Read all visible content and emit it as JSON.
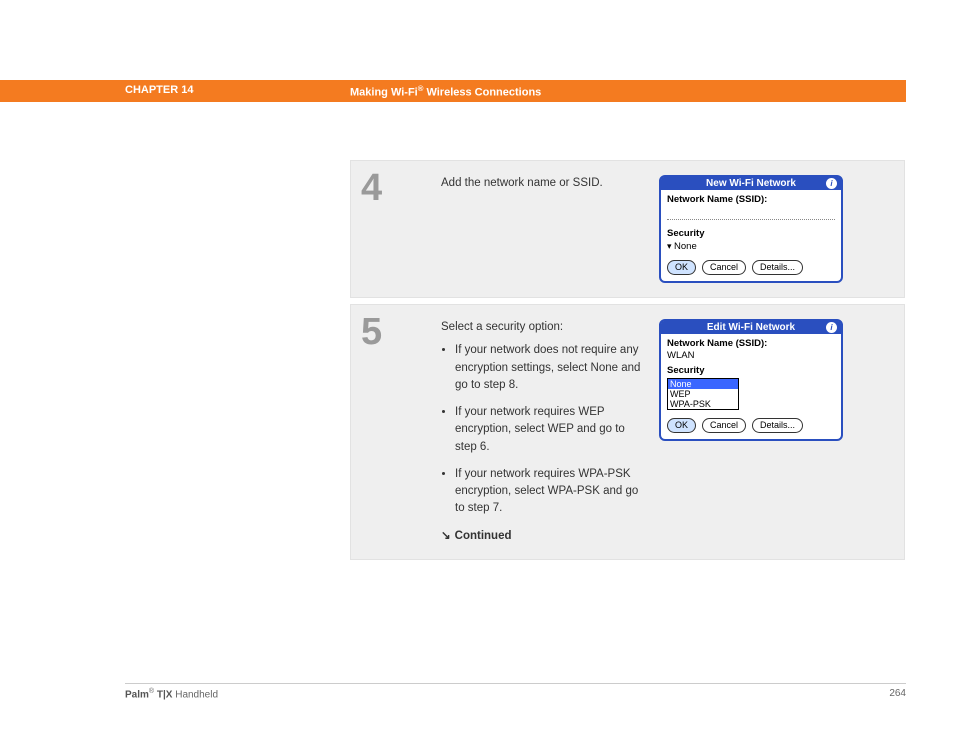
{
  "header": {
    "chapter": "CHAPTER 14",
    "title_pre": "Making Wi-Fi",
    "title_sup": "®",
    "title_post": " Wireless Connections"
  },
  "steps": [
    {
      "num": "4",
      "text": "Add the network name or SSID.",
      "panel": {
        "title": "New Wi-Fi Network",
        "ssid_label": "Network Name (SSID):",
        "ssid_value": "",
        "security_label": "Security",
        "security_value": "None",
        "dropdown_open": false,
        "buttons": {
          "ok": "OK",
          "cancel": "Cancel",
          "details": "Details..."
        }
      }
    },
    {
      "num": "5",
      "intro": "Select a security option:",
      "bullets": [
        "If your network does not require any encryption settings, select None and go to step 8.",
        "If your network requires WEP encryption, select WEP and go to step 6.",
        "If your network requires WPA-PSK encryption, select WPA-PSK and go to step 7."
      ],
      "continued": "Continued",
      "panel": {
        "title": "Edit Wi-Fi Network",
        "ssid_label": "Network Name (SSID):",
        "ssid_value": "WLAN",
        "security_label": "Security",
        "dropdown_open": true,
        "options": [
          "None",
          "WEP",
          "WPA-PSK"
        ],
        "buttons": {
          "ok": "OK",
          "cancel": "Cancel",
          "details": "Details..."
        }
      }
    }
  ],
  "footer": {
    "product_bold": "Palm",
    "product_sup": "®",
    "product_rest": " T|X",
    "product_tail": " Handheld",
    "page": "264"
  }
}
